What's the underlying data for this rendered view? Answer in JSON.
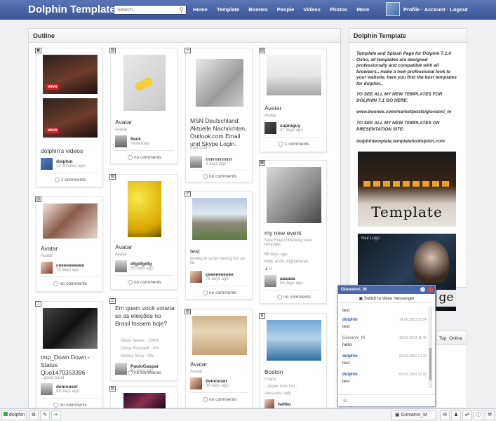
{
  "header": {
    "logo": "Dolphin Template",
    "search_placeholder": "Search...",
    "nav": [
      "Home",
      "Template",
      "Boonex",
      "People",
      "Videos",
      "Photos",
      "More"
    ],
    "user_links": "Profile · Account · Logout"
  },
  "outline": {
    "title": "Outline",
    "cards": [
      {
        "id": "c1",
        "type_icon": "film-icon",
        "title": "dolphin's videos",
        "author": "dolphin",
        "time": "14 minutes ago",
        "comments": "1 comments",
        "badge1": "vevo",
        "badge2": "vevo"
      },
      {
        "id": "c2",
        "type_icon": "image-icon",
        "title": "Avatar",
        "sub": "Avatar",
        "author": "fleck",
        "time": "Yesterday",
        "comments": "no comments"
      },
      {
        "id": "c3",
        "type_icon": "link-icon",
        "title": "MSN Deutschland: Aktuelle Nachrichten, Outlook.com Email und Skype Login.",
        "sub": "msn.com",
        "author": "rrrrrrrrrrrrrrr",
        "time": "9 days ago",
        "comments": "no comments"
      },
      {
        "id": "c4",
        "type_icon": "image-icon",
        "title": "Avatar",
        "sub": "Avatar",
        "author": "supraguy",
        "time": "47 days ago",
        "comments": "1 comments"
      },
      {
        "id": "c5",
        "type_icon": "image-icon",
        "title": "Avatar",
        "sub": "Avatar",
        "author": "ceeeeeeeeee",
        "time": "76 days ago",
        "comments": "no comments"
      },
      {
        "id": "c6",
        "type_icon": "image-icon",
        "title": "Avatar",
        "sub": "Avatar",
        "author": "dfgdfgdfg",
        "time": "63 days ago",
        "comments": "no comments"
      },
      {
        "id": "c7",
        "type_icon": "cart-icon",
        "title": "test",
        "sub": "testing te script having fun so far",
        "author": "ceeeeeeeeee",
        "time": "76 days ago",
        "comments": "no comments"
      },
      {
        "id": "c8",
        "type_icon": "calendar-icon",
        "title": "my new event",
        "sub": "New Event checking new template",
        "sub2": "66 days ago",
        "sub3": "kkjkj, asnlt, Afghanistan",
        "sub4": "0",
        "author": "aaaaaa",
        "time": "56 days ago",
        "comments": "no comments"
      },
      {
        "id": "c9",
        "type_icon": "music-icon",
        "title": "tmp_Down Down - Status Quo1470353396",
        "sub": "...good band",
        "author": "demouser",
        "time": "98 days ago",
        "comments": "no comments"
      },
      {
        "id": "c10",
        "type_icon": "poll-icon",
        "title": "Em quem você votaria se as eleições no Brasil fossem hoje?",
        "poll": [
          "Aécio Neves - 100%",
          "Dilma Rousseff - 0%",
          "Marina Silva - 0%"
        ],
        "author": "PauloGaspar",
        "time": "91 days ago",
        "comments": "no comments"
      },
      {
        "id": "c11",
        "type_icon": "image-icon",
        "title": "Avatar",
        "sub": "Avatar",
        "author": "demouser",
        "time": "98 days ago",
        "comments": "no comments"
      },
      {
        "id": "c12",
        "type_icon": "group-icon",
        "title": "Boston",
        "sub": "0 fans",
        "sub2": "...asper rock fun...",
        "sub3": "sassuolo, Italy",
        "author": "twitko",
        "time": "",
        "comments": ""
      },
      {
        "id": "c13",
        "type_icon": "image-icon"
      }
    ]
  },
  "right_panel": {
    "title": "Dolphin Template",
    "para1": "Template and Splash Page for Dolphin 7.1.0 Osho, all templates are designed professionally and compatible with all browsers.. make a new professional look to your website, here you find the best templates for dolphin..",
    "para2": "TO SEE ALL MY NEW TEMPLATES FOR DOLPHIN 7.1 GO HERE:",
    "para3": "www.boonex.com/market/posts/giovanni_m",
    "para4": "TO SEE ALL MY NEW TEMPLATES ON PRESENTATION SITE:",
    "para5": "dolphintemplate.templatefordolphin.com",
    "promo1_text": "Template",
    "promo2_logo": "Your Logo",
    "promo2_text": "ge"
  },
  "side_tabs": [
    "Top",
    "Online"
  ],
  "chat": {
    "header": "Giovanni_M",
    "switch": "Switch to video messenger",
    "messages": [
      {
        "who": "",
        "time": "",
        "text": "test"
      },
      {
        "who": "dolphin",
        "time": "14.08.2013 12:34",
        "text": "test"
      },
      {
        "who": "Giovanni_M",
        "time": "09.03.2014 11:40",
        "text": "hello"
      },
      {
        "who": "dolphin",
        "time": "09.03.2014 12:30",
        "text": "test"
      },
      {
        "who": "dolphin",
        "time": "09.03.2014 12:30",
        "text": "test"
      }
    ]
  },
  "bottombar": {
    "user": "dolphin",
    "chat_tab": "Giovanni_M"
  }
}
